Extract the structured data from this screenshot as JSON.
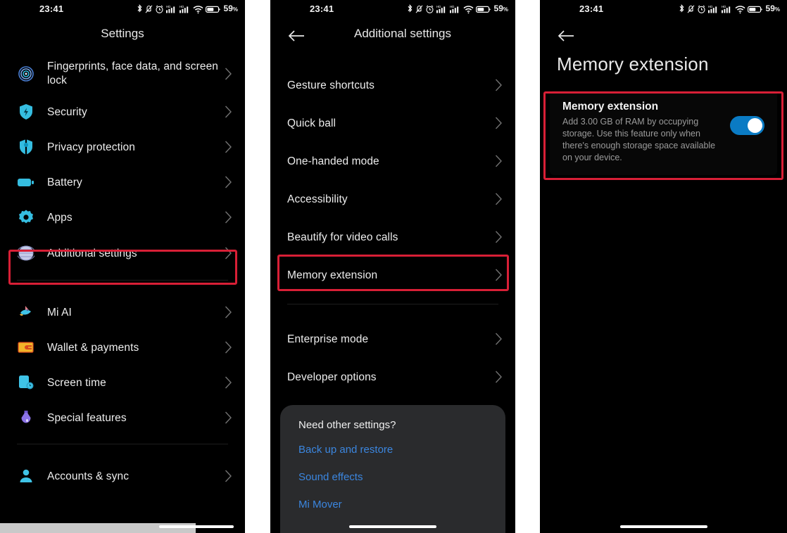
{
  "statusbar": {
    "time": "23:41",
    "battery_percent": "59",
    "percent_symbol": "%",
    "icons": [
      "bluetooth-icon",
      "vibrate-mute-icon",
      "alarm-icon",
      "signal-1-icon",
      "signal-2-icon",
      "wifi-icon",
      "battery-icon"
    ]
  },
  "colors": {
    "highlight_red": "#d81f36",
    "accent_blue": "#3b86df",
    "toggle_blue": "#0a7bc4",
    "icon_cyan": "#35bde0",
    "background": "#000000"
  },
  "panel1": {
    "title": "Settings",
    "rows": [
      {
        "label": "Fingerprints, face data, and screen lock",
        "icon": "fingerprint-icon"
      },
      {
        "label": "Security",
        "icon": "shield-icon"
      },
      {
        "label": "Privacy protection",
        "icon": "privacy-icon"
      },
      {
        "label": "Battery",
        "icon": "battery-icon"
      },
      {
        "label": "Apps",
        "icon": "apps-gear-icon"
      },
      {
        "label": "Additional settings",
        "icon": "additional-settings-icon"
      }
    ],
    "rows_group2": [
      {
        "label": "Mi AI",
        "icon": "mi-ai-icon"
      },
      {
        "label": "Wallet & payments",
        "icon": "wallet-icon"
      },
      {
        "label": "Screen time",
        "icon": "screen-time-icon"
      },
      {
        "label": "Special features",
        "icon": "special-features-icon"
      }
    ],
    "rows_group3": [
      {
        "label": "Accounts & sync",
        "icon": "accounts-sync-icon"
      }
    ],
    "highlighted_row": "Additional settings"
  },
  "panel2": {
    "title": "Additional settings",
    "back": "back-arrow-icon",
    "rows": [
      {
        "label": "Gesture shortcuts"
      },
      {
        "label": "Quick ball"
      },
      {
        "label": "One-handed mode"
      },
      {
        "label": "Accessibility"
      },
      {
        "label": "Beautify for video calls"
      },
      {
        "label": "Memory extension"
      }
    ],
    "rows_group2": [
      {
        "label": "Enterprise mode"
      },
      {
        "label": "Developer options"
      }
    ],
    "highlighted_row": "Memory extension",
    "card": {
      "title": "Need other settings?",
      "links": [
        "Back up and restore",
        "Sound effects",
        "Mi Mover"
      ]
    }
  },
  "panel3": {
    "back": "back-arrow-icon",
    "title": "Memory extension",
    "card": {
      "title": "Memory extension",
      "description": "Add 3.00 GB of RAM by occupying storage. Use this feature only when there's enough storage space available on your device.",
      "toggle_state": "on"
    }
  }
}
